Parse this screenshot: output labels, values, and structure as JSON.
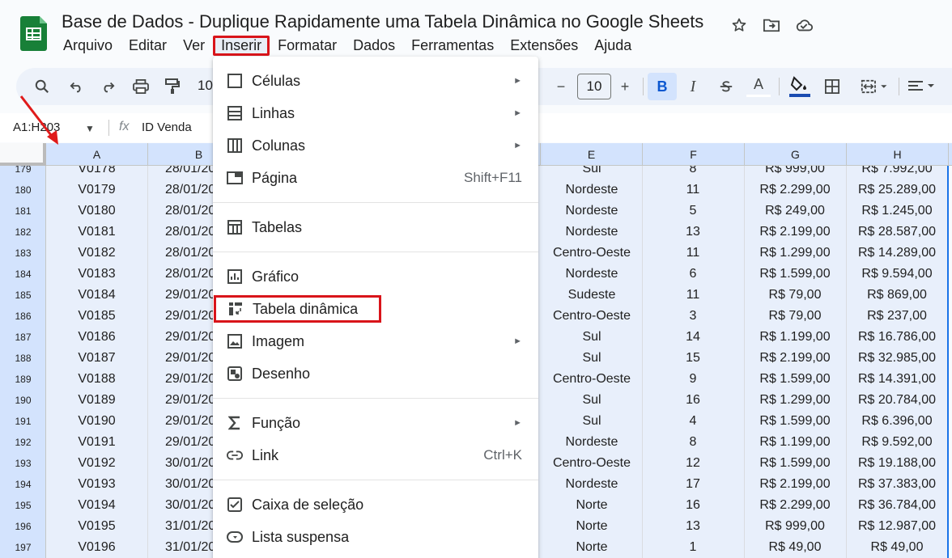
{
  "app": {
    "doc_title": "Base de Dados - Duplique Rapidamente uma Tabela Dinâmica no Google Sheets",
    "icons": [
      "star-icon",
      "move-to-folder-icon",
      "cloud-status-icon"
    ]
  },
  "menubar": [
    "Arquivo",
    "Editar",
    "Ver",
    "Inserir",
    "Formatar",
    "Dados",
    "Ferramentas",
    "Extensões",
    "Ajuda"
  ],
  "toolbar": {
    "zoom_partial": "10",
    "font_size": "10",
    "decrease_label": "−",
    "increase_label": "+",
    "bold_label": "B",
    "italic_label": "I",
    "text_color_label": "A"
  },
  "formula_bar": {
    "name_box": "A1:H203",
    "fx": "fx",
    "content": "ID Venda"
  },
  "columns": [
    "A",
    "B",
    "E",
    "F",
    "G",
    "H"
  ],
  "rows": [
    {
      "num": "179",
      "a": "V0178",
      "b": "28/01/20",
      "e": "Sul",
      "f": "8",
      "g": "R$ 999,00",
      "h": "R$ 7.992,00"
    },
    {
      "num": "180",
      "a": "V0179",
      "b": "28/01/20",
      "e": "Nordeste",
      "f": "11",
      "g": "R$ 2.299,00",
      "h": "R$ 25.289,00"
    },
    {
      "num": "181",
      "a": "V0180",
      "b": "28/01/20",
      "e": "Nordeste",
      "f": "5",
      "g": "R$ 249,00",
      "h": "R$ 1.245,00"
    },
    {
      "num": "182",
      "a": "V0181",
      "b": "28/01/20",
      "e": "Nordeste",
      "f": "13",
      "g": "R$ 2.199,00",
      "h": "R$ 28.587,00"
    },
    {
      "num": "183",
      "a": "V0182",
      "b": "28/01/20",
      "e": "Centro-Oeste",
      "f": "11",
      "g": "R$ 1.299,00",
      "h": "R$ 14.289,00"
    },
    {
      "num": "184",
      "a": "V0183",
      "b": "28/01/20",
      "e": "Nordeste",
      "f": "6",
      "g": "R$ 1.599,00",
      "h": "R$ 9.594,00"
    },
    {
      "num": "185",
      "a": "V0184",
      "b": "29/01/20",
      "e": "Sudeste",
      "f": "11",
      "g": "R$ 79,00",
      "h": "R$ 869,00"
    },
    {
      "num": "186",
      "a": "V0185",
      "b": "29/01/20",
      "e": "Centro-Oeste",
      "f": "3",
      "g": "R$ 79,00",
      "h": "R$ 237,00"
    },
    {
      "num": "187",
      "a": "V0186",
      "b": "29/01/20",
      "e": "Sul",
      "f": "14",
      "g": "R$ 1.199,00",
      "h": "R$ 16.786,00"
    },
    {
      "num": "188",
      "a": "V0187",
      "b": "29/01/20",
      "e": "Sul",
      "f": "15",
      "g": "R$ 2.199,00",
      "h": "R$ 32.985,00"
    },
    {
      "num": "189",
      "a": "V0188",
      "b": "29/01/20",
      "e": "Centro-Oeste",
      "f": "9",
      "g": "R$ 1.599,00",
      "h": "R$ 14.391,00"
    },
    {
      "num": "190",
      "a": "V0189",
      "b": "29/01/20",
      "e": "Sul",
      "f": "16",
      "g": "R$ 1.299,00",
      "h": "R$ 20.784,00"
    },
    {
      "num": "191",
      "a": "V0190",
      "b": "29/01/20",
      "e": "Sul",
      "f": "4",
      "g": "R$ 1.599,00",
      "h": "R$ 6.396,00"
    },
    {
      "num": "192",
      "a": "V0191",
      "b": "29/01/20",
      "e": "Nordeste",
      "f": "8",
      "g": "R$ 1.199,00",
      "h": "R$ 9.592,00"
    },
    {
      "num": "193",
      "a": "V0192",
      "b": "30/01/20",
      "e": "Centro-Oeste",
      "f": "12",
      "g": "R$ 1.599,00",
      "h": "R$ 19.188,00"
    },
    {
      "num": "194",
      "a": "V0193",
      "b": "30/01/20",
      "e": "Nordeste",
      "f": "17",
      "g": "R$ 2.199,00",
      "h": "R$ 37.383,00"
    },
    {
      "num": "195",
      "a": "V0194",
      "b": "30/01/20",
      "e": "Norte",
      "f": "16",
      "g": "R$ 2.299,00",
      "h": "R$ 36.784,00"
    },
    {
      "num": "196",
      "a": "V0195",
      "b": "31/01/20",
      "e": "Norte",
      "f": "13",
      "g": "R$ 999,00",
      "h": "R$ 12.987,00"
    },
    {
      "num": "197",
      "a": "V0196",
      "b": "31/01/20",
      "e": "Norte",
      "f": "1",
      "g": "R$ 49,00",
      "h": "R$ 49,00"
    }
  ],
  "insert_menu": [
    {
      "label": "Células",
      "icon": "cell-icon",
      "submenu": true
    },
    {
      "label": "Linhas",
      "icon": "rows-icon",
      "submenu": true
    },
    {
      "label": "Colunas",
      "icon": "columns-icon",
      "submenu": true
    },
    {
      "label": "Página",
      "icon": "sheet-tab-icon",
      "shortcut": "Shift+F11"
    },
    {
      "label": "Tabelas",
      "icon": "table-icon"
    },
    {
      "label": "Gráfico",
      "icon": "chart-icon"
    },
    {
      "label": "Tabela dinâmica",
      "icon": "pivot-table-icon"
    },
    {
      "label": "Imagem",
      "icon": "image-icon",
      "submenu": true
    },
    {
      "label": "Desenho",
      "icon": "drawing-icon"
    },
    {
      "label": "Função",
      "icon": "sigma-icon",
      "submenu": true
    },
    {
      "label": "Link",
      "icon": "link-icon",
      "shortcut": "Ctrl+K"
    },
    {
      "label": "Caixa de seleção",
      "icon": "checkbox-icon"
    },
    {
      "label": "Lista suspensa",
      "icon": "dropdown-icon"
    }
  ],
  "colors": {
    "highlight_red": "#d9141a",
    "selection_blue": "#d3e3fd",
    "sheets_green": "#188038"
  }
}
